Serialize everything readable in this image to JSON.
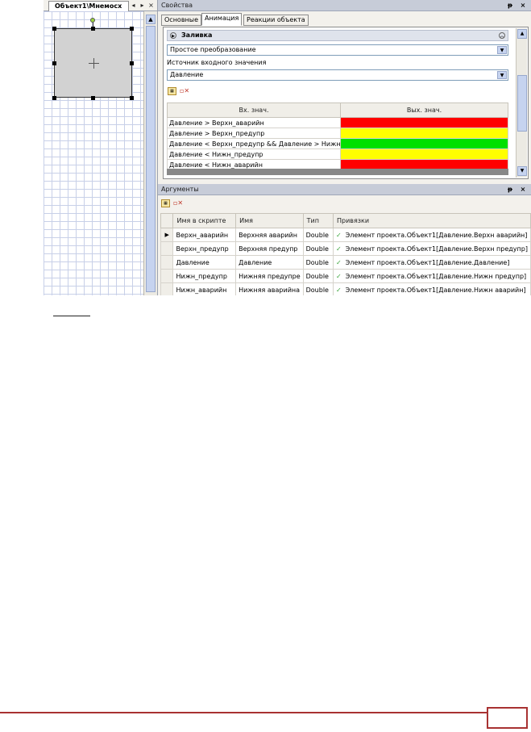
{
  "designer": {
    "tab_title": "Объект1\\Мнемосх",
    "tab_prev": "◂",
    "tab_next": "▸",
    "tab_close": "×"
  },
  "properties": {
    "title": "Свойства",
    "pin": "ᵽ",
    "close": "×",
    "tabs": [
      "Основные",
      "Анимация",
      "Реакции объекта"
    ],
    "active_tab": "Анимация",
    "section_title": "Заливка",
    "transform_value": "Простое преобразование",
    "input_source_label": "Источник входного значения",
    "input_source_value": "Давление",
    "table": {
      "headers": [
        "Вх. знач.",
        "Вых. знач."
      ],
      "rows": [
        {
          "condition": "Давление > Верхн_аварийн",
          "color": "#ff0000"
        },
        {
          "condition": "Давление > Верхн_предупр",
          "color": "#ffff00"
        },
        {
          "condition": "Давление < Верхн_предупр && Давление > Нижн_предупр",
          "color": "#00e000"
        },
        {
          "condition": "Давление < Нижн_предупр",
          "color": "#ffff00"
        },
        {
          "condition": "Давление < Нижн_аварийн",
          "color": "#ff0000"
        }
      ]
    }
  },
  "arguments": {
    "title": "Аргументы",
    "pin": "ᵽ",
    "close": "×",
    "headers": [
      "Имя в скрипте",
      "Имя",
      "Тип",
      "Привязки"
    ],
    "rows": [
      {
        "script_name": "Верхн_аварийн",
        "name": "Верхняя аварийн",
        "type": "Double",
        "binding": "Элемент проекта.Объект1[Давление.Верхн аварийн]"
      },
      {
        "script_name": "Верхн_предупр",
        "name": "Верхняя предупр",
        "type": "Double",
        "binding": "Элемент проекта.Объект1[Давление.Верхн предупр]"
      },
      {
        "script_name": "Давление",
        "name": "Давление",
        "type": "Double",
        "binding": "Элемент проекта.Объект1[Давление.Давление]"
      },
      {
        "script_name": "Нижн_предупр",
        "name": "Нижняя предупре",
        "type": "Double",
        "binding": "Элемент проекта.Объект1[Давление.Нижн предупр]"
      },
      {
        "script_name": "Нижн_аварийн",
        "name": "Нижняя аварийна",
        "type": "Double",
        "binding": "Элемент проекта.Объект1[Давление.Нижн аварийн]"
      }
    ],
    "current_row_marker": "▶"
  }
}
